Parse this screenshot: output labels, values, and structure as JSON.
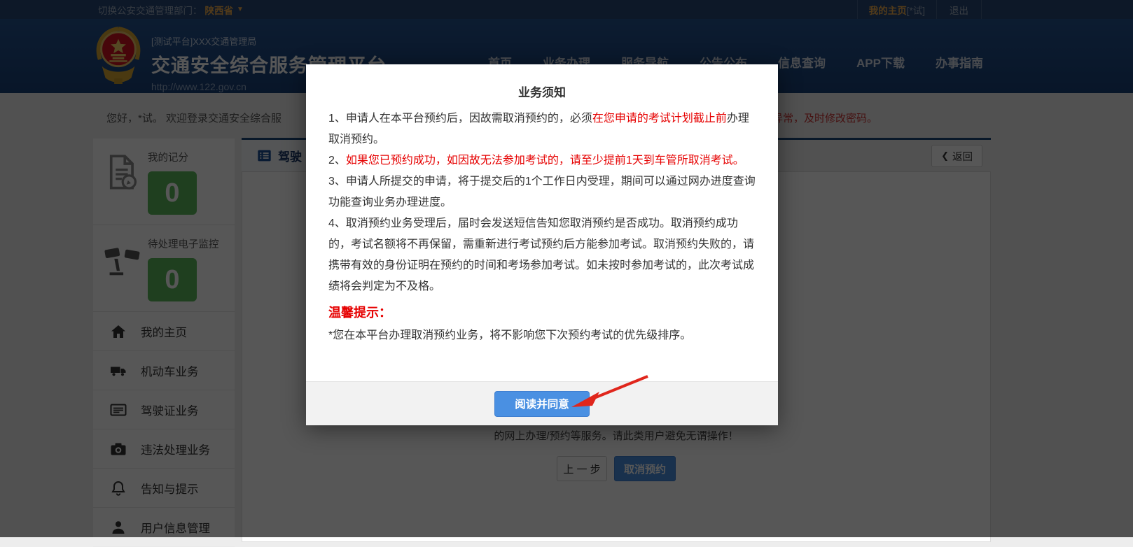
{
  "topbar": {
    "switch_label": "切换公安交通管理部门：",
    "region": "陕西省",
    "home_link": "我的主页",
    "home_suffix": "[*试]",
    "logout": "退出"
  },
  "header": {
    "agency": "[测试平台]XXX交通管理局",
    "title": "交通安全综合服务管理平台",
    "url": "http://www.122.gov.cn",
    "nav": [
      "首页",
      "业务办理",
      "服务导航",
      "公告公布",
      "信息查询",
      "APP下载",
      "办事指南"
    ]
  },
  "welcome": {
    "left": "您好，*试。 欢迎登录交通安全综合服",
    "right_warning": "异常，及时修改密码。"
  },
  "sidebar": {
    "stats": [
      {
        "key": "score",
        "label": "我的记分",
        "value": "0",
        "icon": "score-document-icon"
      },
      {
        "key": "monitor",
        "label": "待处理电子监控",
        "value": "0",
        "icon": "surveillance-camera-icon"
      }
    ],
    "menu": [
      {
        "key": "home",
        "label": "我的主页",
        "icon": "home-icon"
      },
      {
        "key": "vehicle",
        "label": "机动车业务",
        "icon": "vehicle-icon"
      },
      {
        "key": "license",
        "label": "驾驶证业务",
        "icon": "license-icon"
      },
      {
        "key": "violation",
        "label": "违法处理业务",
        "icon": "camera-icon"
      },
      {
        "key": "notice",
        "label": "告知与提示",
        "icon": "bell-icon"
      },
      {
        "key": "user",
        "label": "用户信息管理",
        "icon": "user-icon"
      }
    ]
  },
  "content": {
    "tab_label": "驾驶",
    "back_icon": "❮",
    "back_label": "返回",
    "notice_line": "的网上办理/预约等服务。请此类用户避免无谓操作！",
    "prev_button": "上 一 步",
    "cancel_button": "取消预约"
  },
  "modal": {
    "title": "业务须知",
    "paragraphs": [
      {
        "segments": [
          {
            "text": "1、申请人在本平台预约后，因故需取消预约的，必须",
            "red": false
          },
          {
            "text": "在您申请的考试计划截止前",
            "red": true
          },
          {
            "text": "办理取消预约。",
            "red": false
          }
        ]
      },
      {
        "segments": [
          {
            "text": "2、",
            "red": false
          },
          {
            "text": "如果您已预约成功，如因故无法参加考试的，请至少提前1天到车管所取消考试。",
            "red": true
          }
        ]
      },
      {
        "segments": [
          {
            "text": "3、申请人所提交的申请，将于提交后的1个工作日内受理，期间可以通过网办进度查询功能查询业务办理进度。",
            "red": false
          }
        ]
      },
      {
        "segments": [
          {
            "text": "4、取消预约业务受理后，届时会发送短信告知您取消预约是否成功。取消预约成功的，考试名额将不再保留，需重新进行考试预约后方能参加考试。取消预约失败的，请携带有效的身份证明在预约的时间和考场参加考试。如未按时参加考试的，此次考试成绩将会判定为不及格。",
            "red": false
          }
        ]
      }
    ],
    "tip_heading": "温馨提示：",
    "tip_text": "*您在本平台办理取消预约业务，将不影响您下次预约考试的优先级排序。",
    "agree_button": "阅读并同意"
  },
  "colors": {
    "header_blue": "#1d4c96",
    "accent_blue": "#4a90e2",
    "badge_green": "#5cb85c",
    "warning_red": "#e60000",
    "gold": "#f0ad4e"
  }
}
